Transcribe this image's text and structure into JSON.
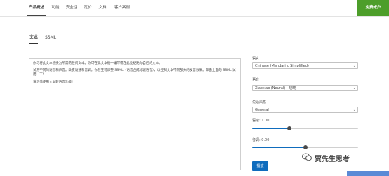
{
  "nav": {
    "items": [
      {
        "label": "产品概述",
        "active": true
      },
      {
        "label": "功能",
        "active": false
      },
      {
        "label": "安全性",
        "active": false
      },
      {
        "label": "定价",
        "active": false
      },
      {
        "label": "文档",
        "active": false
      },
      {
        "label": "客户案例",
        "active": false
      }
    ],
    "free_account": "免费帐户"
  },
  "tabs": [
    {
      "label": "文本",
      "active": true
    },
    {
      "label": "SSML",
      "active": false
    }
  ],
  "editor": {
    "paragraph1": "你可将此文本替换为所需的任何文本。你可在此文本框中编写或在此处粘贴你自己的文本。",
    "paragraph2": "试用不同的语言和声音。改变语速和音调。你甚至可调整 SSML（语音合成标记语言），以控制文本不同部分的发音效果。单击上面的 SSML 试用一下!",
    "paragraph3": "请尽情使用文本转语音功能!"
  },
  "settings": {
    "language_label": "语言",
    "language_value": "Chinese (Mandarin, Simplified)",
    "voice_label": "语音",
    "voice_value": "Xiaoxiao (Neural) - 晓晓",
    "style_label": "说话风格",
    "style_value": "General",
    "rate_label": "语速: 1.00",
    "rate_value": 0.35,
    "pitch_label": "音调: 0.00",
    "pitch_value": 0.5,
    "play_label": "播放"
  },
  "watermark": "贾先生思考",
  "colors": {
    "accent": "#0f6cbd",
    "free_button": "#4d9e2a"
  }
}
